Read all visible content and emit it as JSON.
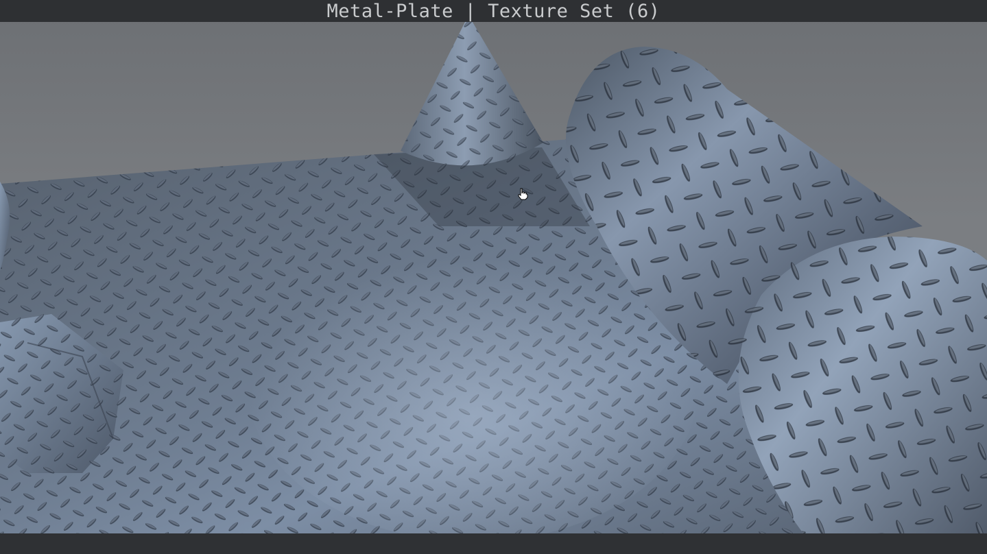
{
  "window": {
    "title": "Metal-Plate | Texture Set (6)"
  },
  "cursor": {
    "icon": "hand-pointer-icon"
  },
  "scene": {
    "objects": [
      "plane",
      "cone",
      "cylinder",
      "cylinder",
      "cube",
      "sphere"
    ],
    "material": "Metal-Plate",
    "colors": {
      "background": "#76797d",
      "metal_light": "#8a9cb2",
      "metal_mid": "#5f6d80",
      "metal_dark": "#3a4350",
      "bar": "#2e3033"
    }
  }
}
